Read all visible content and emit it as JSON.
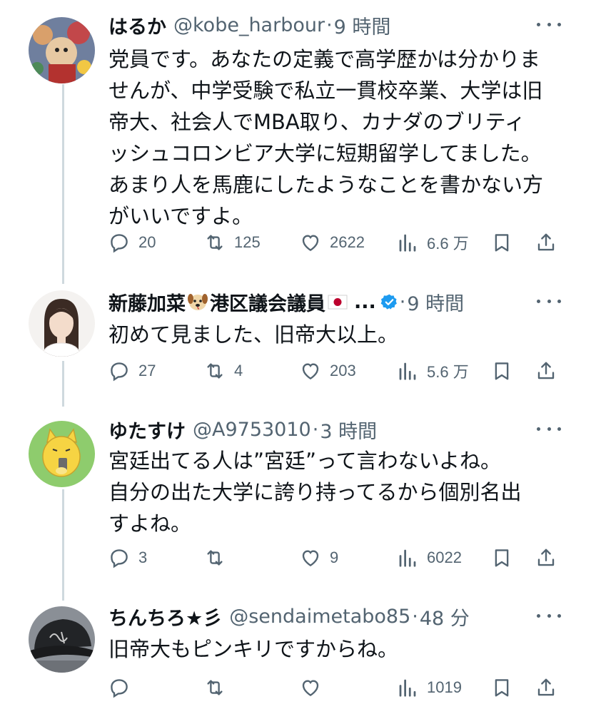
{
  "tweets": [
    {
      "name": "はるか",
      "handle": "@kobe_harbour",
      "time": "9 時間",
      "lines": [
        "党員です。あなたの定義で高学歴かは分かりま",
        "せんが、中学受験で私立一貫校卒業、大学は旧",
        "帝大、社会人でMBA取り、カナダのブリティ",
        "ッシュコロンビア大学に短期留学してました。",
        "あまり人を馬鹿にしたようなことを書かない方",
        "がいいですよ。"
      ],
      "replies": "20",
      "reposts": "125",
      "likes": "2622",
      "views": "6.6 万"
    },
    {
      "name_part1": "新藤加菜",
      "name_part2": "港区議会議員",
      "name_ellipsis": "...",
      "time": "9 時間",
      "verified": true,
      "emoji_dog": "dog-face-emoji",
      "emoji_flag": "japan-flag-emoji",
      "lines": [
        "初めて見ました、旧帝大以上。"
      ],
      "replies": "27",
      "reposts": "4",
      "likes": "203",
      "views": "5.6 万"
    },
    {
      "name": "ゆたすけ",
      "handle": "@A9753010",
      "time": "3 時間",
      "lines": [
        "宮廷出てる人は”宮廷”って言わないよね。",
        "自分の出た大学に誇り持ってるから個別名出",
        "すよね。"
      ],
      "replies": "3",
      "reposts": "",
      "likes": "9",
      "views": "6022"
    },
    {
      "name": "ちんちろ★彡",
      "handle": "@sendaimetabo85",
      "time": "48 分",
      "lines": [
        "旧帝大もピンキリですからね。"
      ],
      "replies": "",
      "reposts": "",
      "likes": "",
      "views": "1019"
    }
  ],
  "colors": {
    "text": "#0f1419",
    "secondary": "#536471",
    "thread_line": "#cfd9de",
    "verified_blue": "#1d9bf0"
  },
  "icons": [
    "reply-icon",
    "repost-icon",
    "like-icon",
    "views-icon",
    "bookmark-icon",
    "share-icon",
    "more-icon",
    "verified-badge-icon"
  ]
}
